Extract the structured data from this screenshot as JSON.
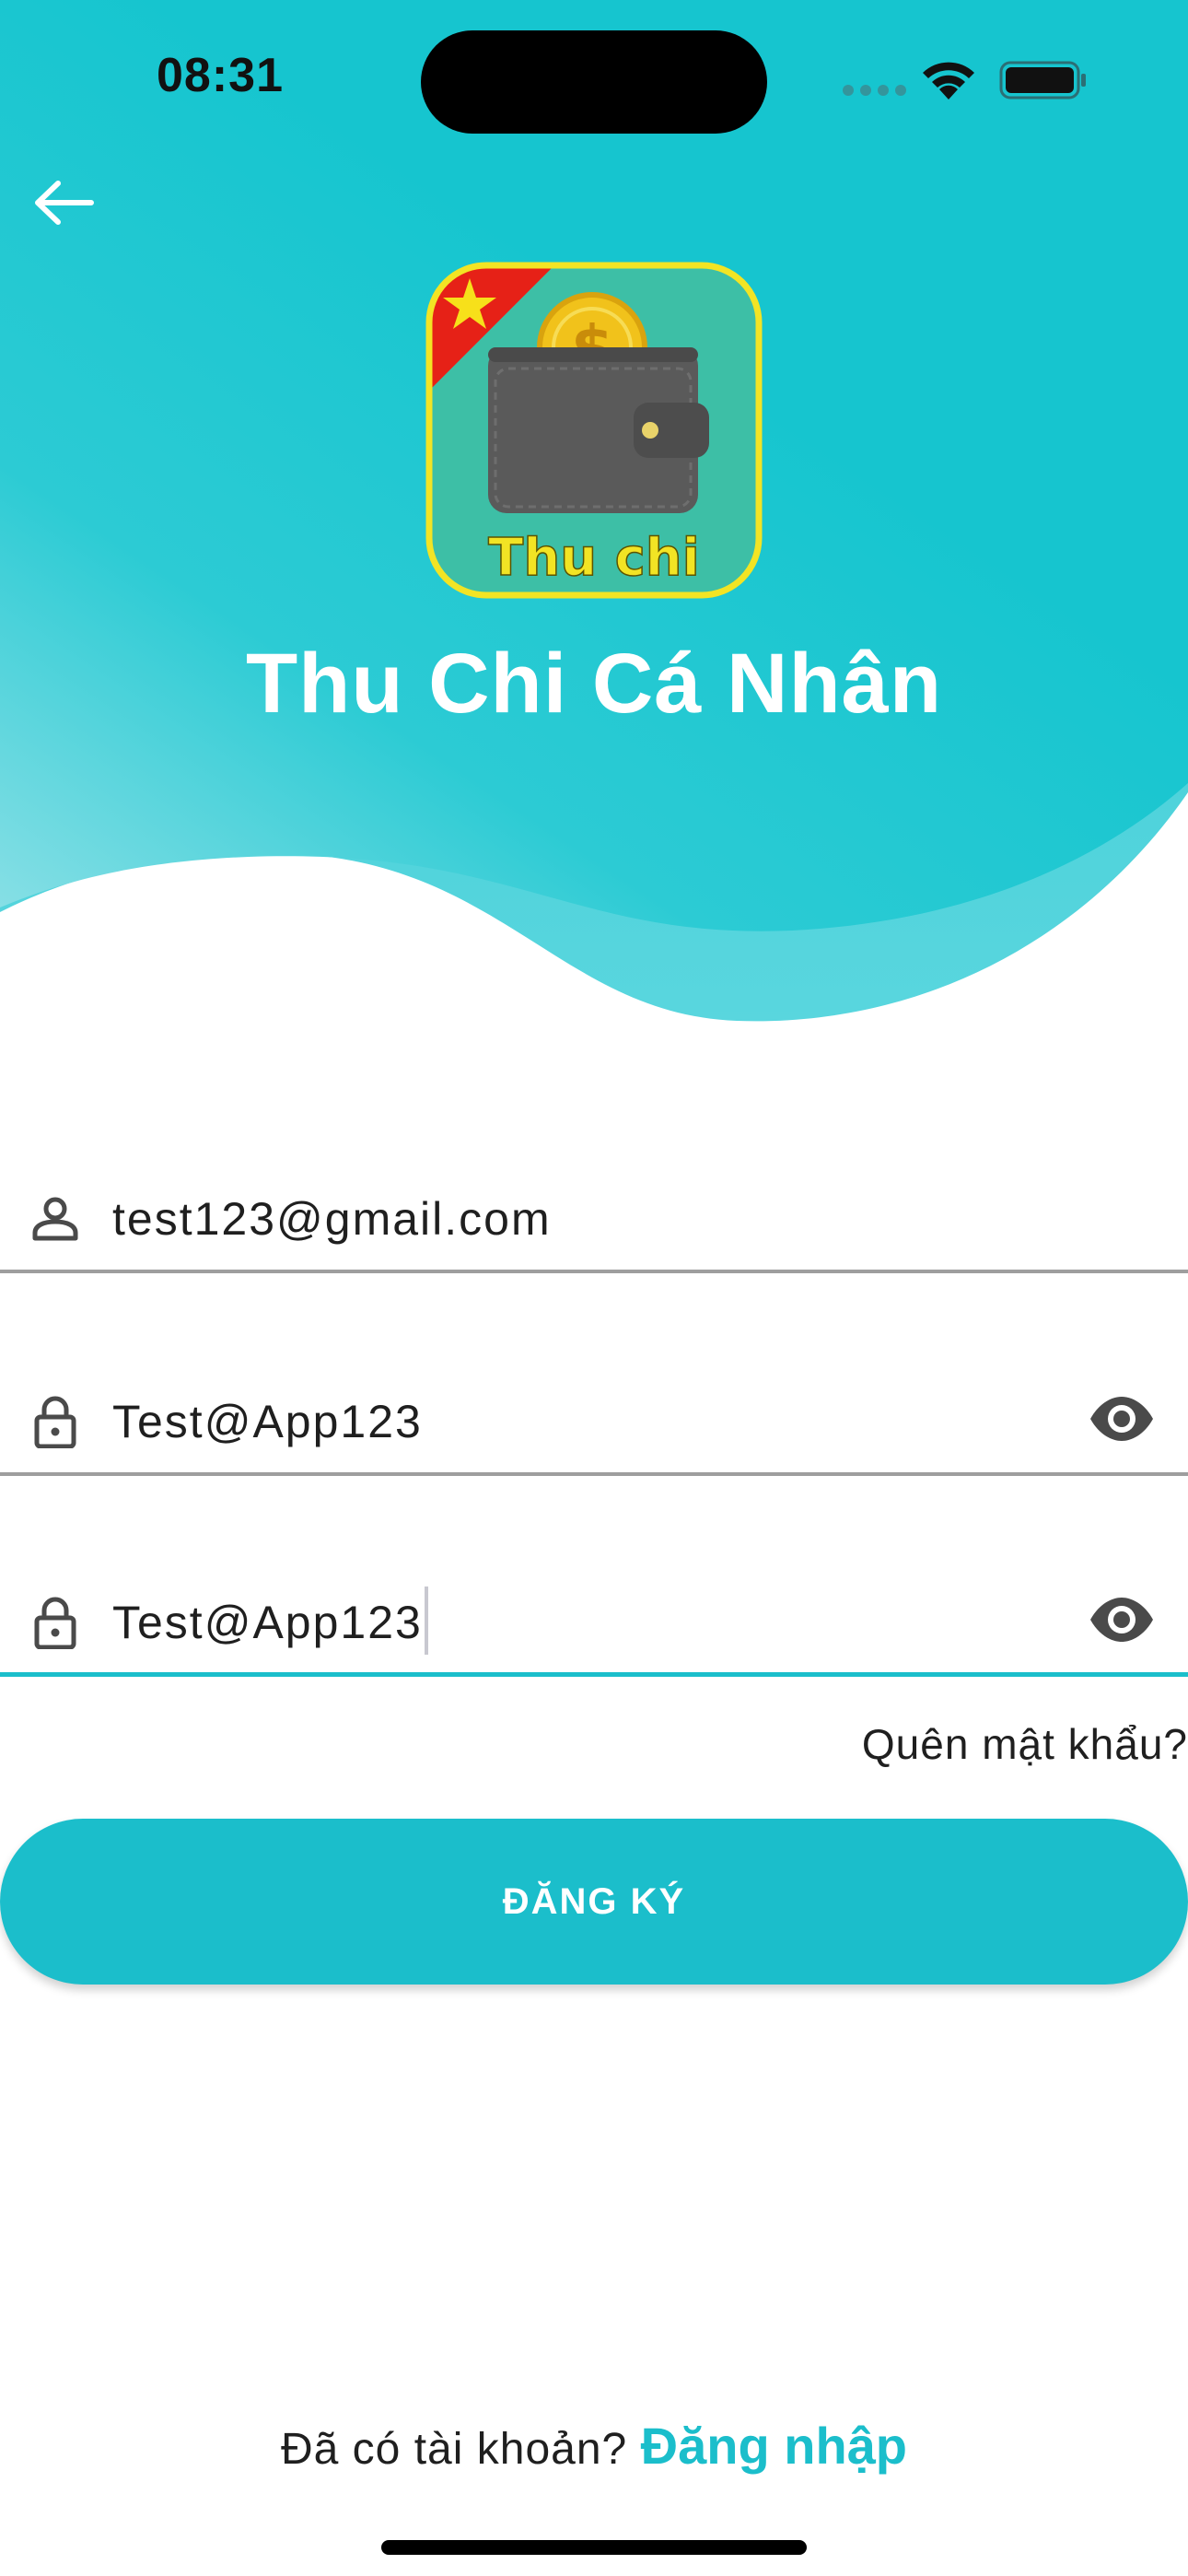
{
  "status_bar": {
    "time": "08:31",
    "wifi_icon": "wifi-icon",
    "battery_icon": "battery-icon",
    "signal_icon": "cellular-signal-icon"
  },
  "header": {
    "back_icon": "arrow-left-icon",
    "logo": {
      "label": "Thu chi",
      "icon": "wallet-coin-icon",
      "flag_star_icon": "star-icon"
    },
    "title": "Thu Chi Cá Nhân"
  },
  "form": {
    "email": {
      "icon": "person-icon",
      "value": "test123@gmail.com"
    },
    "password": {
      "icon": "lock-icon",
      "value": "Test@App123",
      "toggle_icon": "eye-icon"
    },
    "confirm_password": {
      "icon": "lock-icon",
      "value": "Test@App123",
      "toggle_icon": "eye-icon"
    },
    "forgot_password": "Quên mật khẩu?",
    "submit_label": "ĐĂNG KÝ"
  },
  "footer": {
    "prompt": "Đã có tài khoản?",
    "login_link": "Đăng nhập"
  },
  "colors": {
    "accent": "#1bbecb",
    "header_gradient_start": "#7fdde4",
    "header_gradient_end": "#16c5cf",
    "logo_green": "#3dbfa6",
    "logo_yellow": "#f2e424",
    "flag_red": "#e62117"
  }
}
